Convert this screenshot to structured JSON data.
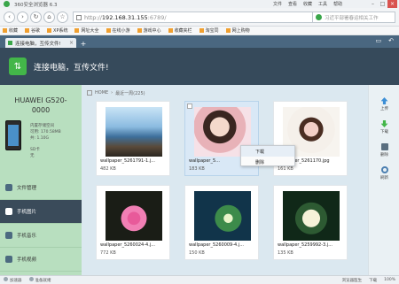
{
  "browser": {
    "title": "360安全浏览器 6.3",
    "menus": [
      "文件",
      "查看",
      "收藏",
      "工具",
      "帮助"
    ],
    "url": {
      "protocol": "http://",
      "host": "192.168.31.155",
      "port": ":6789/"
    },
    "search_placeholder": "习近平部署春运相关工作",
    "favorites": [
      "收藏",
      "谷歌",
      "XP系统",
      "网址大全",
      "在线小游",
      "游戏中心",
      "收藏夹栏",
      "淘宝同",
      "网上购物"
    ],
    "tab_title": "连接电脑，互传文件!"
  },
  "app": {
    "title": "连接电脑，互传文件!",
    "device": {
      "name": "HUAWEI G520-0000",
      "storage_label": "内置存储空间",
      "storage_free": "可用: 170.58MB",
      "storage_total": "共: 1.10G",
      "sd_label": "SD卡",
      "sd_value": "无"
    },
    "menu": [
      {
        "label": "文件管理",
        "active": false
      },
      {
        "label": "手机图片",
        "active": true
      },
      {
        "label": "手机音乐",
        "active": false
      },
      {
        "label": "手机视频",
        "active": false
      }
    ],
    "breadcrumb": {
      "home": "HOME",
      "current": "最近一周(225)"
    },
    "photos": [
      {
        "name": "wallpaper_5261791-1.j...",
        "size": "482 KB",
        "selected": false
      },
      {
        "name": "wallpaper_5...",
        "size": "183 KB",
        "selected": true
      },
      {
        "name": "wallpaper_5261170.jpg",
        "size": "161 KB",
        "selected": false
      },
      {
        "name": "wallpaper_5260024-4.j...",
        "size": "772 KB",
        "selected": false
      },
      {
        "name": "wallpaper_5260009-4.j...",
        "size": "150 KB",
        "selected": false
      },
      {
        "name": "wallpaper_5259992-3.j...",
        "size": "135 KB",
        "selected": false
      }
    ],
    "context_menu": [
      "下载",
      "删除"
    ],
    "toolbar": [
      "上传",
      "下载",
      "删除",
      "刷新"
    ]
  },
  "statusbar": {
    "left": [
      "加速器",
      "准备就绪"
    ],
    "right": [
      "浏览器医生",
      "下载",
      "100%"
    ]
  }
}
